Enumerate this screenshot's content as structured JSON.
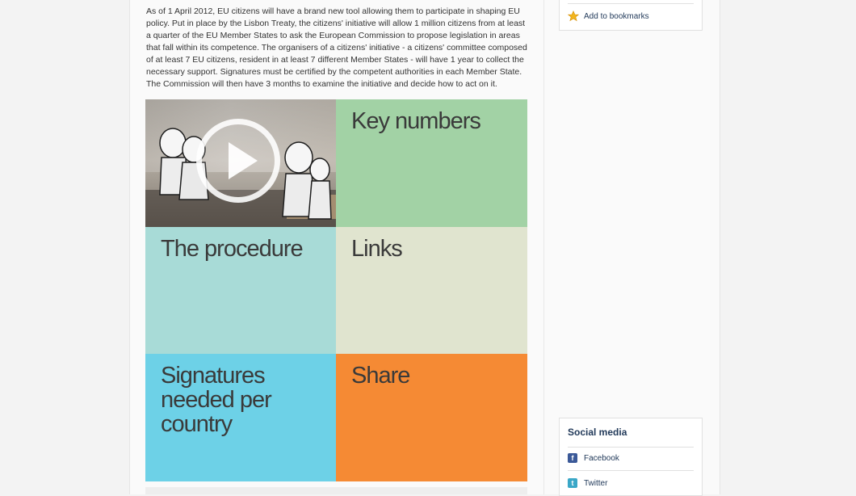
{
  "intro": {
    "text": "As of 1 April 2012, EU citizens will have a brand new tool allowing them to participate in shaping EU policy. Put in place by the Lisbon Treaty, the citizens' initiative will allow 1 million citizens from at least a quarter of the EU Member States to ask the European Commission to propose legislation in areas that fall within its competence. The organisers of a citizens' initiative - a citizens' committee composed of at least 7 EU citizens, resident in at least 7 different Member States - will have 1 year to collect the necessary support. Signatures must be certified by the competent authorities in each Member State. The Commission will then have 3 months to examine the initiative and decide how to act on it."
  },
  "tiles": {
    "key_numbers": "Key numbers",
    "procedure": "The procedure",
    "links": "Links",
    "signatures": "Signatures\nneeded per\ncountry",
    "share": "Share"
  },
  "sidebar": {
    "bookmarks_label": "Add to bookmarks",
    "social_heading": "Social media",
    "facebook_label": "Facebook",
    "twitter_label": "Twitter"
  },
  "colors": {
    "tile_green": "#a2d2a5",
    "tile_teal": "#a8dbd7",
    "tile_beige": "#e0e4cf",
    "tile_sky": "#6dd1e7",
    "tile_orange": "#f58a34",
    "link_text": "#223a5a"
  },
  "icons": {
    "video": "play-icon",
    "bookmark": "star-icon",
    "facebook": "facebook-icon",
    "twitter": "twitter-icon"
  }
}
